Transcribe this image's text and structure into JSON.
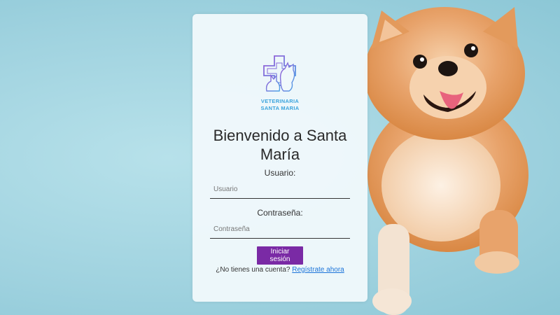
{
  "brand": {
    "line1": "VETERINARIA",
    "line2": "SANTA MARIA"
  },
  "login": {
    "title": "Bienvenido a Santa María",
    "username_label": "Usuario:",
    "username_placeholder": "Usuario",
    "username_value": "",
    "password_label": "Contraseña:",
    "password_placeholder": "Contraseña",
    "password_value": "",
    "submit_label": "Iniciar sesión",
    "register_prompt": "¿No tienes una cuenta?",
    "register_link": "Regístrate ahora"
  },
  "colors": {
    "accent": "#7a2aa5",
    "link": "#1a73d9",
    "brand_text": "#3aa3dc",
    "background": "#a9d8e3"
  },
  "icons": {
    "logo": "clinic-cross-dog-cat-icon",
    "photo": "pomeranian-dog-photo"
  }
}
